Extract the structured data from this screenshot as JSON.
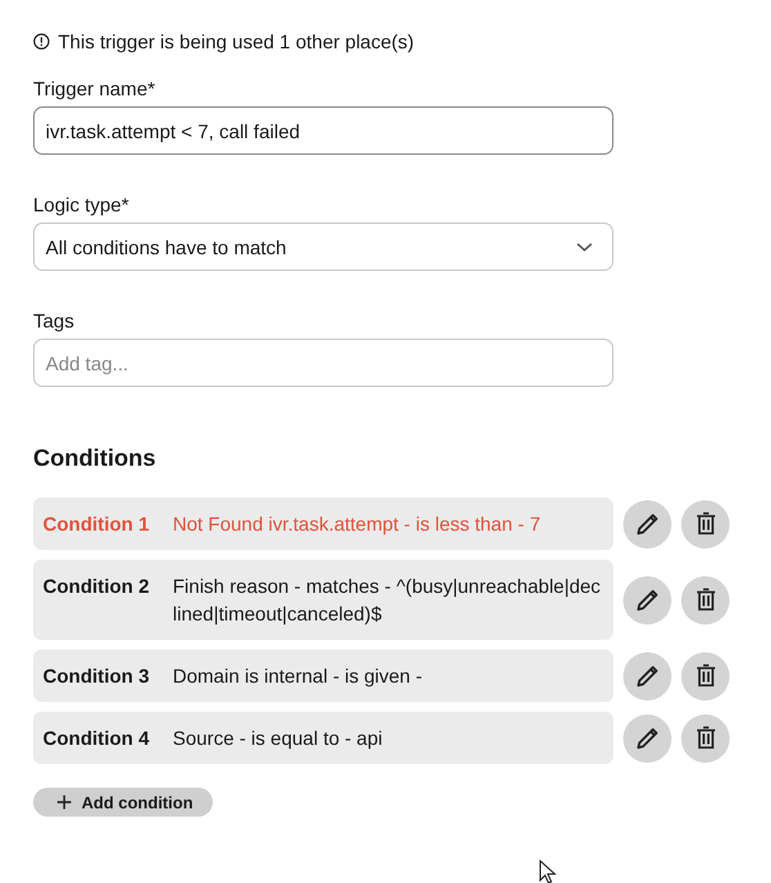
{
  "notice": {
    "text": "This trigger is being used 1 other place(s)"
  },
  "trigger_name": {
    "label": "Trigger name*",
    "value": "ivr.task.attempt < 7, call failed"
  },
  "logic_type": {
    "label": "Logic type*",
    "value": "All conditions have to match"
  },
  "tags": {
    "label": "Tags",
    "placeholder": "Add tag..."
  },
  "conditions": {
    "title": "Conditions",
    "items": [
      {
        "label": "Condition 1",
        "text": "Not Found ivr.task.attempt - is less than - 7",
        "error": true
      },
      {
        "label": "Condition 2",
        "text": "Finish reason - matches - ^(busy|unreachable|declined|timeout|canceled)$",
        "error": false
      },
      {
        "label": "Condition 3",
        "text": "Domain is internal - is given -",
        "error": false
      },
      {
        "label": "Condition 4",
        "text": "Source - is equal to - api",
        "error": false
      }
    ],
    "add_button": "Add condition"
  }
}
